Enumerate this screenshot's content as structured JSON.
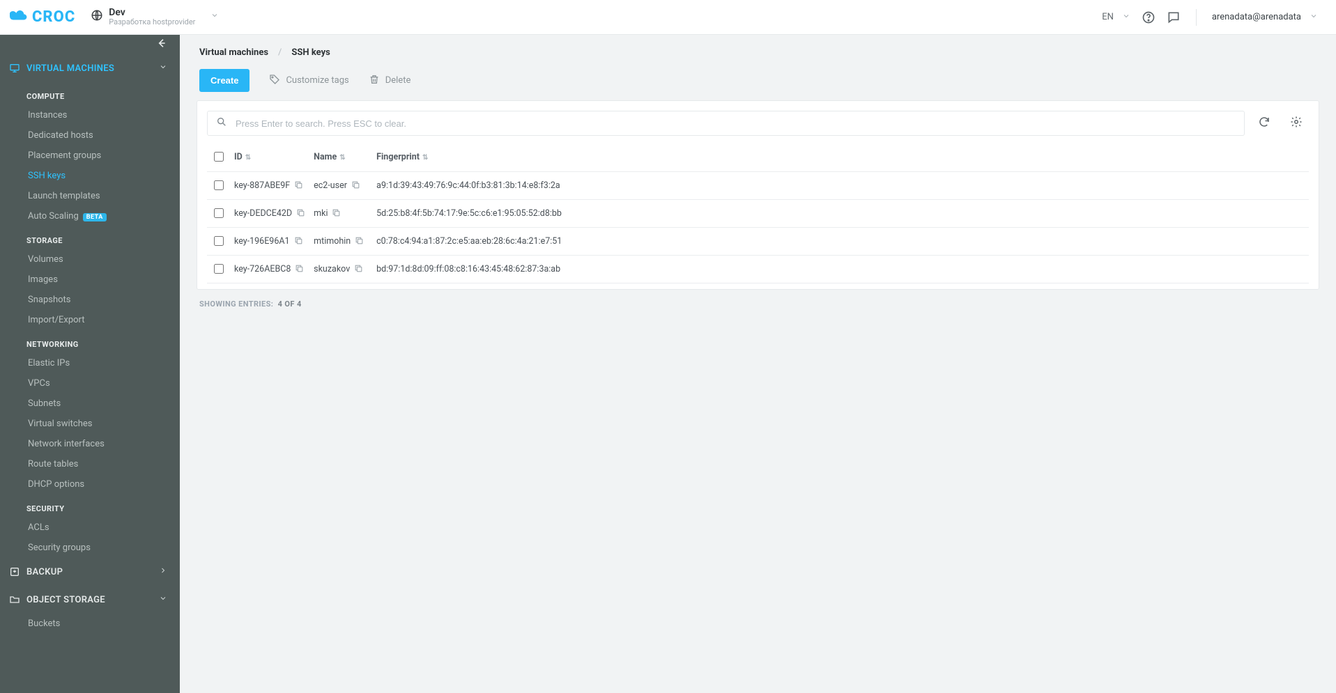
{
  "brand": "CROC",
  "env": {
    "name": "Dev",
    "sub": "Разработка hostprovider"
  },
  "header": {
    "lang": "EN",
    "user": "arenadata@arenadata"
  },
  "sidebar": {
    "sections": {
      "vm": {
        "label": "VIRTUAL MACHINES",
        "expanded": true
      },
      "backup": {
        "label": "BACKUP",
        "expanded": false
      },
      "obj": {
        "label": "OBJECT STORAGE",
        "expanded": true
      }
    },
    "groups": {
      "compute": {
        "label": "COMPUTE",
        "items": [
          {
            "id": "instances",
            "label": "Instances"
          },
          {
            "id": "dedicated",
            "label": "Dedicated hosts"
          },
          {
            "id": "placement",
            "label": "Placement groups"
          },
          {
            "id": "sshkeys",
            "label": "SSH keys",
            "active": true
          },
          {
            "id": "launchtpl",
            "label": "Launch templates"
          },
          {
            "id": "autoscale",
            "label": "Auto Scaling",
            "badge": "BETA"
          }
        ]
      },
      "storage": {
        "label": "STORAGE",
        "items": [
          {
            "id": "volumes",
            "label": "Volumes"
          },
          {
            "id": "images",
            "label": "Images"
          },
          {
            "id": "snapshots",
            "label": "Snapshots"
          },
          {
            "id": "impexp",
            "label": "Import/Export"
          }
        ]
      },
      "networking": {
        "label": "NETWORKING",
        "items": [
          {
            "id": "eips",
            "label": "Elastic IPs"
          },
          {
            "id": "vpcs",
            "label": "VPCs"
          },
          {
            "id": "subnets",
            "label": "Subnets"
          },
          {
            "id": "vswitch",
            "label": "Virtual switches"
          },
          {
            "id": "nics",
            "label": "Network interfaces"
          },
          {
            "id": "routes",
            "label": "Route tables"
          },
          {
            "id": "dhcp",
            "label": "DHCP options"
          }
        ]
      },
      "security": {
        "label": "SECURITY",
        "items": [
          {
            "id": "acls",
            "label": "ACLs"
          },
          {
            "id": "sg",
            "label": "Security groups"
          }
        ]
      },
      "buckets": {
        "items": [
          {
            "id": "buckets",
            "label": "Buckets"
          }
        ]
      }
    }
  },
  "breadcrumb": {
    "root": "Virtual machines",
    "current": "SSH keys"
  },
  "toolbar": {
    "create": "Create",
    "customize": "Customize tags",
    "delete": "Delete"
  },
  "search": {
    "placeholder": "Press Enter to search. Press ESC to clear."
  },
  "table": {
    "cols": {
      "id": "ID",
      "name": "Name",
      "fp": "Fingerprint"
    },
    "rows": [
      {
        "id": "key-887ABE9F",
        "name": "ec2-user",
        "fp": "a9:1d:39:43:49:76:9c:44:0f:b3:81:3b:14:e8:f3:2a"
      },
      {
        "id": "key-DEDCE42D",
        "name": "mki",
        "fp": "5d:25:b8:4f:5b:74:17:9e:5c:c6:e1:95:05:52:d8:bb"
      },
      {
        "id": "key-196E96A1",
        "name": "mtimohin",
        "fp": "c0:78:c4:94:a1:87:2c:e5:aa:eb:28:6c:4a:21:e7:51"
      },
      {
        "id": "key-726AEBC8",
        "name": "skuzakov",
        "fp": "bd:97:1d:8d:09:ff:08:c8:16:43:45:48:62:87:3a:ab"
      }
    ]
  },
  "entries": {
    "label": "SHOWING ENTRIES:",
    "value": "4 OF 4"
  }
}
